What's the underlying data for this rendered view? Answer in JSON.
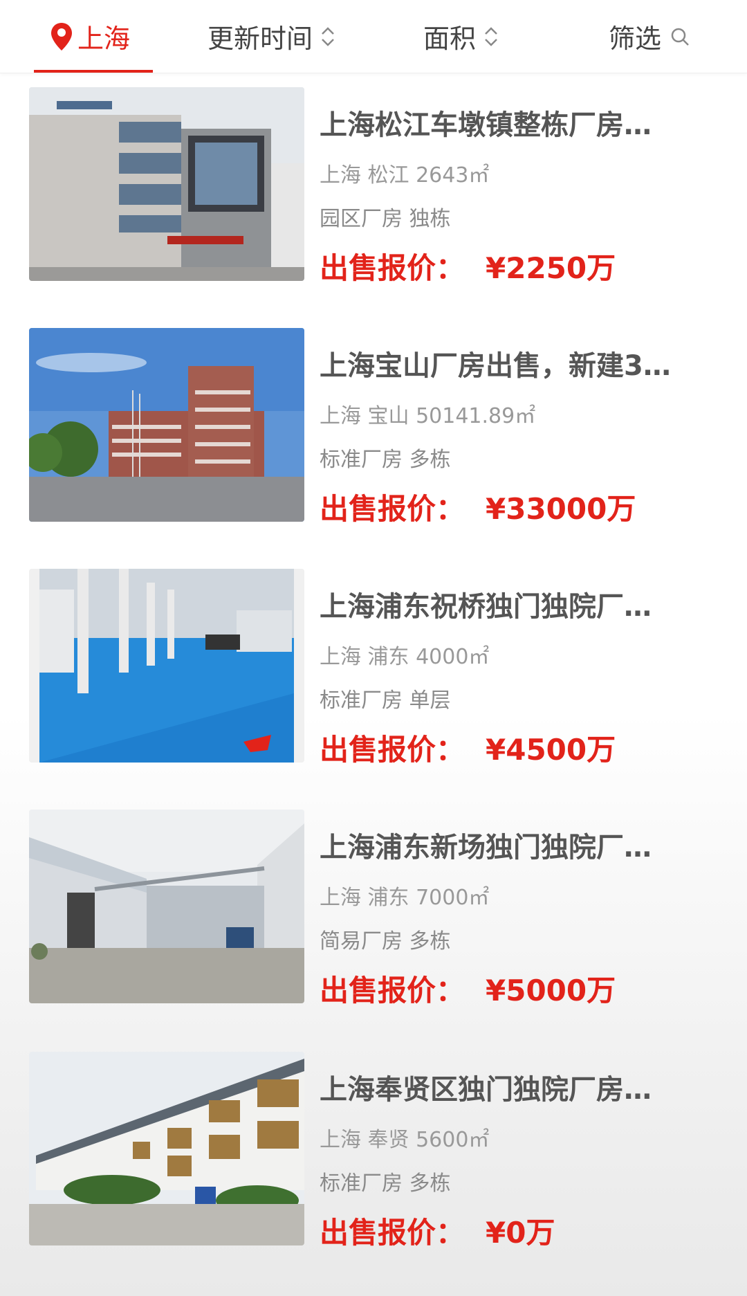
{
  "filter_bar": {
    "city": "上海",
    "sort_time": "更新时间",
    "sort_area": "面积",
    "filter": "筛选",
    "accent_color": "#e2231a",
    "icons": {
      "city": "location-pin-icon",
      "sort": "sort-updown-icon",
      "search": "search-icon"
    }
  },
  "listings": [
    {
      "title": "上海松江车墩镇整栋厂房…",
      "meta": "上海 松江 2643㎡",
      "tags": "园区厂房 独栋",
      "price_label": "出售报价：",
      "price": "¥2250万"
    },
    {
      "title": "上海宝山厂房出售，新建3…",
      "meta": "上海 宝山 50141.89㎡",
      "tags": "标准厂房 多栋",
      "price_label": "出售报价：",
      "price": "¥33000万"
    },
    {
      "title": "上海浦东祝桥独门独院厂…",
      "meta": "上海 浦东 4000㎡",
      "tags": "标准厂房 单层",
      "price_label": "出售报价：",
      "price": "¥4500万"
    },
    {
      "title": "上海浦东新场独门独院厂…",
      "meta": "上海 浦东 7000㎡",
      "tags": "简易厂房 多栋",
      "price_label": "出售报价：",
      "price": "¥5000万"
    },
    {
      "title": "上海奉贤区独门独院厂房…",
      "meta": "上海 奉贤 5600㎡",
      "tags": "标准厂房 多栋",
      "price_label": "出售报价：",
      "price": "¥0万"
    }
  ]
}
